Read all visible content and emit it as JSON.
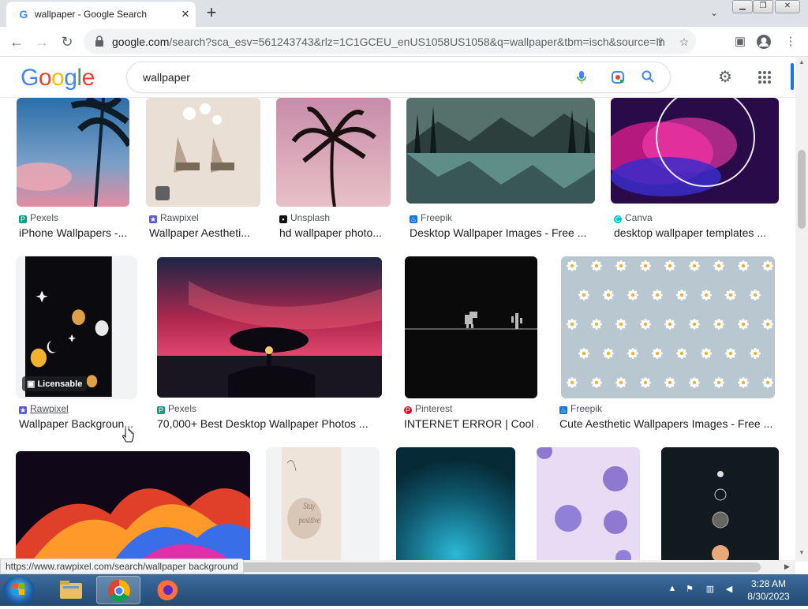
{
  "browser": {
    "tab_title": "wallpaper - Google Search",
    "url_host": "google.com",
    "url_path": "/search?sca_esv=561243743&rlz=1C1GCEU_enUS1058US1058&q=wallpaper&tbm=isch&source=In...",
    "status_url": "https://www.rawpixel.com/search/wallpaper background"
  },
  "google": {
    "logo_letters": [
      "G",
      "o",
      "o",
      "g",
      "l",
      "e"
    ],
    "logo_colors": [
      "#4285F4",
      "#EA4335",
      "#FBBC05",
      "#4285F4",
      "#34A853",
      "#EA4335"
    ],
    "query": "wallpaper"
  },
  "results": [
    {
      "source": "Pexels",
      "caption": "iPhone Wallpapers -...",
      "fav_color": "#05a081"
    },
    {
      "source": "Rawpixel",
      "caption": "Wallpaper Aestheti...",
      "fav_color": "#5a5ad8"
    },
    {
      "source": "Unsplash",
      "caption": "hd wallpaper photo...",
      "fav_color": "#111111"
    },
    {
      "source": "Freepik",
      "caption": "Desktop Wallpaper Images - Free ...",
      "fav_color": "#1273eb"
    },
    {
      "source": "Canva",
      "caption": "desktop wallpaper templates ...",
      "fav_color": "#00c4cc"
    },
    {
      "source": "Rawpixel",
      "caption": "Wallpaper Backgroun...",
      "fav_color": "#5a5ad8",
      "badge": "Licensable"
    },
    {
      "source": "Pexels",
      "caption": "70,000+ Best Desktop Wallpaper Photos ...",
      "fav_color": "#05a081"
    },
    {
      "source": "Pinterest",
      "caption": "INTERNET ERROR | Cool ...",
      "fav_color": "#e60023"
    },
    {
      "source": "Freepik",
      "caption": "Cute Aesthetic Wallpapers Images - Free ...",
      "fav_color": "#1273eb"
    }
  ],
  "taskbar": {
    "time": "3:28 AM",
    "date": "8/30/2023"
  }
}
